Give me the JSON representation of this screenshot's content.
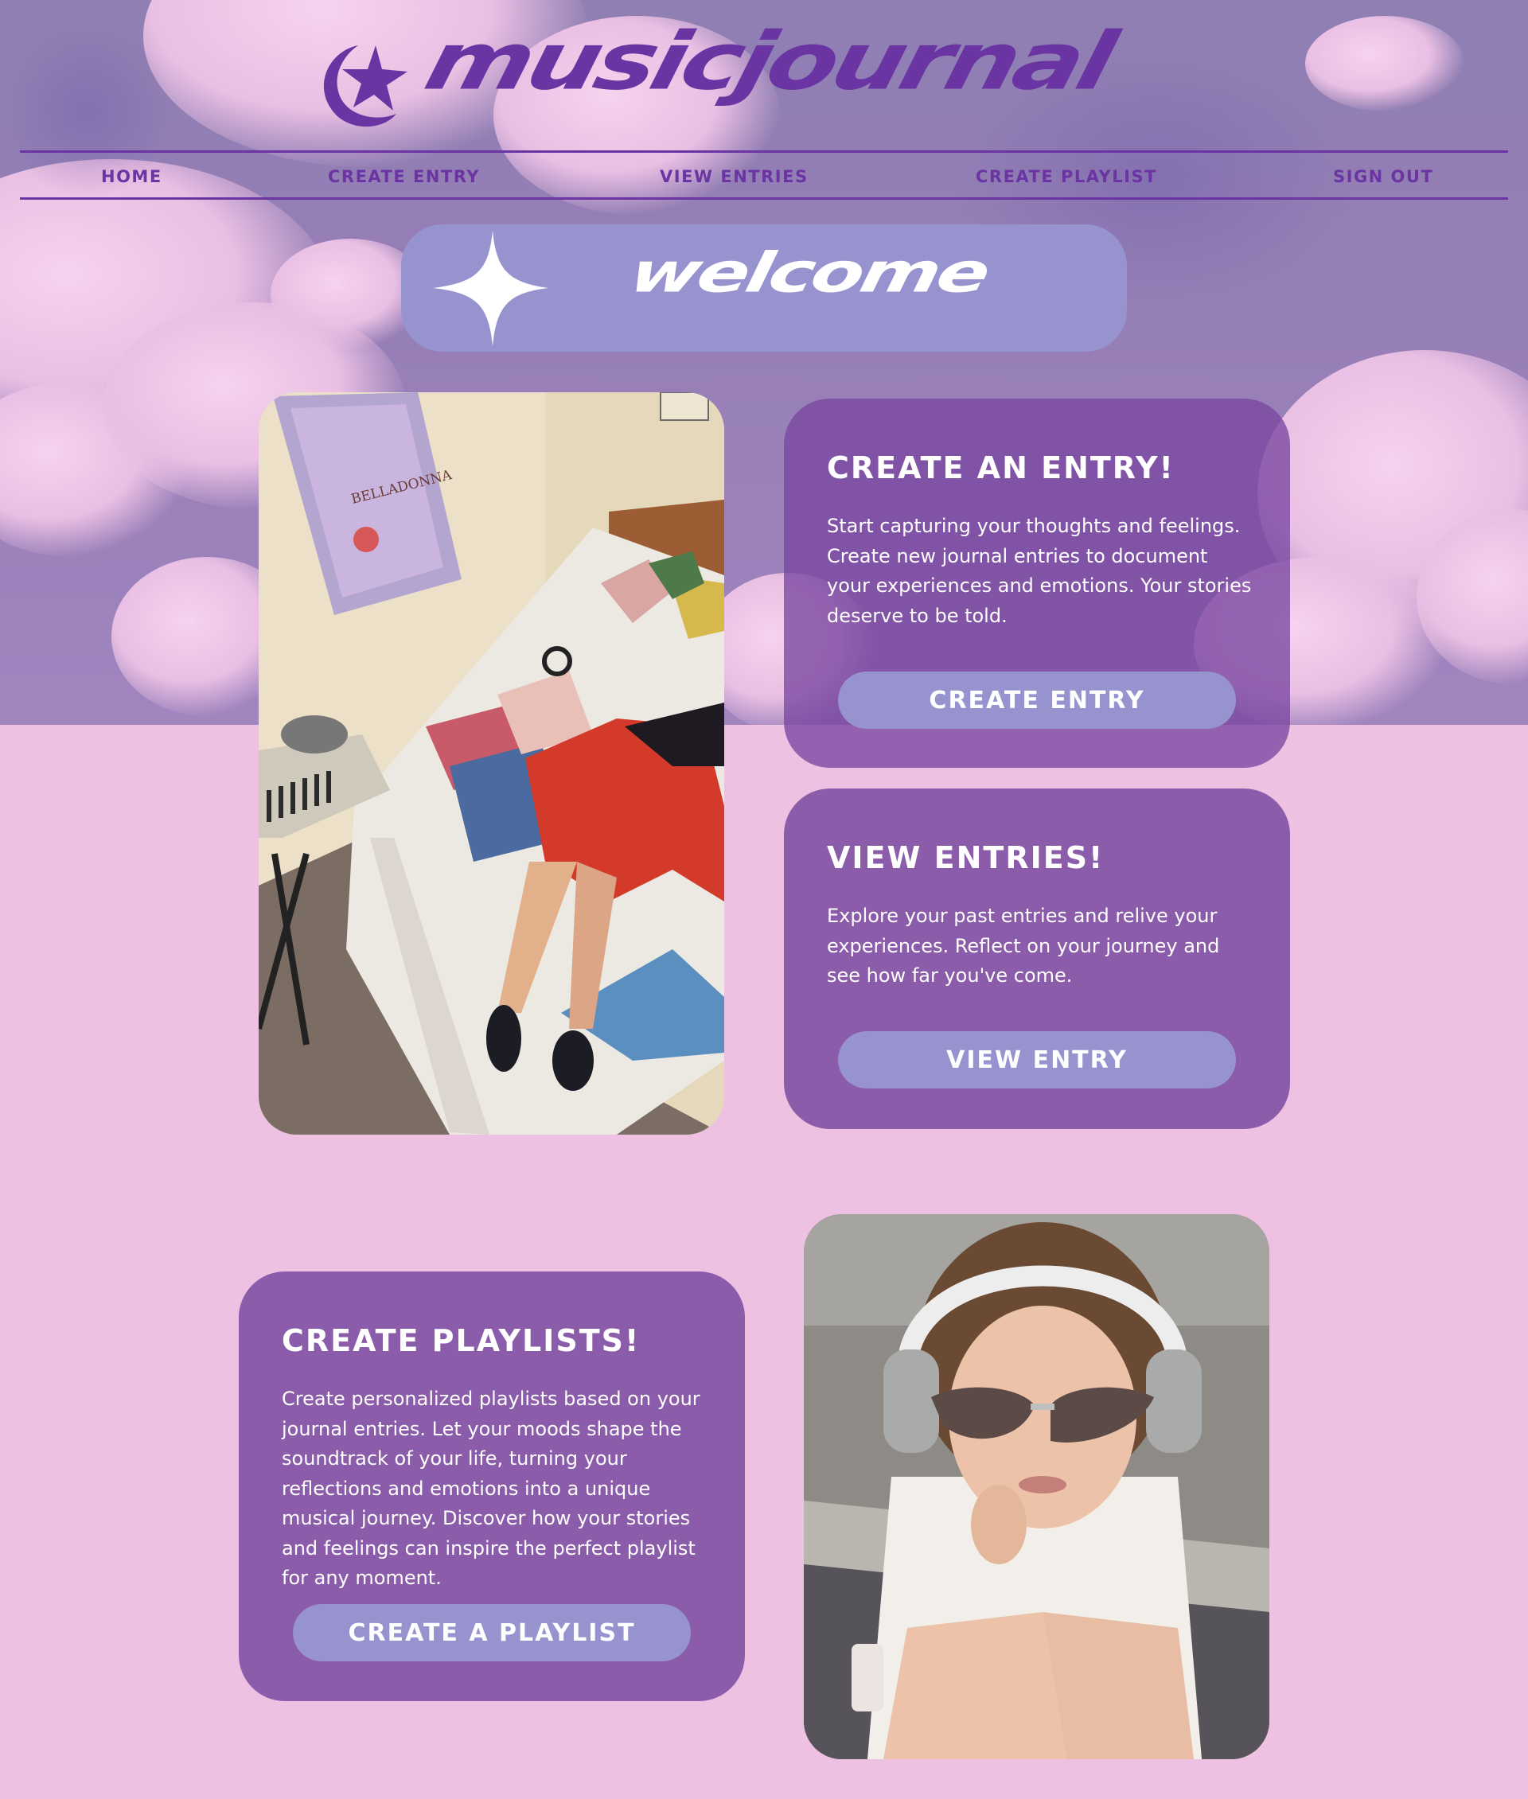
{
  "brand": {
    "logo_text": "musicjournal",
    "logo_icon": "star-moon-icon",
    "color": "#6a35a3"
  },
  "nav": {
    "items": [
      {
        "label": "HOME"
      },
      {
        "label": "CREATE ENTRY"
      },
      {
        "label": "VIEW ENTRIES"
      },
      {
        "label": "CREATE PLAYLIST"
      },
      {
        "label": "SIGN OUT"
      }
    ]
  },
  "welcome": {
    "text": "welcome",
    "icon": "sparkle-star-icon",
    "background": "#9793cf"
  },
  "cards": [
    {
      "title": "CREATE AN ENTRY!",
      "body": "Start capturing your thoughts and feelings. Create new journal entries to document your experiences and emotions. Your stories deserve to be told.",
      "button": "CREATE ENTRY"
    },
    {
      "title": "VIEW ENTRIES!",
      "body": "Explore your past entries and relive your experiences. Reflect on your journey and see how far you've come.",
      "button": "VIEW ENTRY"
    },
    {
      "title": "CREATE PLAYLISTS!",
      "body": "Create personalized playlists based on your journal entries. Let your moods shape the soundtrack of your life, turning your reflections and emotions into a unique musical journey. Discover how your stories and feelings can inspire the perfect playlist for any moment.",
      "button": "CREATE A PLAYLIST"
    }
  ],
  "colors": {
    "page_background": "#eec1e2",
    "card": "#8b5ca9",
    "button": "#9793cf",
    "text_on_card": "#ffffff"
  }
}
